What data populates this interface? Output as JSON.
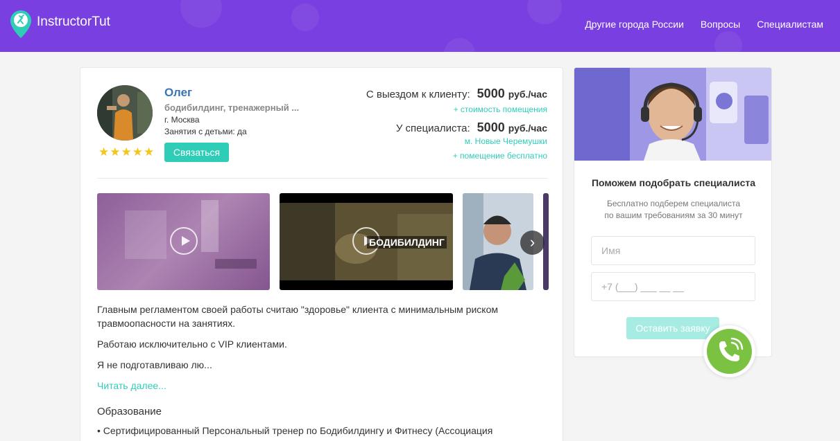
{
  "header": {
    "logo_text": "InstructorTut",
    "nav": [
      "Другие города России",
      "Вопросы",
      "Специалистам"
    ]
  },
  "profile": {
    "name": "Олег",
    "specialization": "бодибилдинг, тренажерный ...",
    "city": "г. Москва",
    "kids": "Занятия с детьми: да",
    "rating": 5,
    "contact_label": "Связаться",
    "prices": {
      "visit_label": "С выездом к клиенту:",
      "visit_value": "5000",
      "visit_unit": "руб./час",
      "visit_note": "+ стоимость помещения",
      "own_label": "У специалиста:",
      "own_value": "5000",
      "own_unit": "руб./час",
      "own_metro": "м. Новые Черемушки",
      "own_note": "+ помещение бесплатно"
    },
    "media": {
      "video2_caption": "БОДИБИЛДИНГ",
      "next_arrow": "›"
    },
    "description": [
      "Главным регламентом своей работы считаю \"здоровье\" клиента с минимальным риском травмоопасности на занятиях.",
      "Работаю исключительно с VIP клиентами.",
      "Я не подготавливаю лю..."
    ],
    "read_more": "Читать далее...",
    "education_title": "Образование",
    "education_item": "• Сертифицированный Персональный тренер по Бодибилдингу и Фитнесу (Ассоциация"
  },
  "sidebar": {
    "title": "Поможем подобрать специалиста",
    "subtitle_line1": "Бесплатно подберем специалиста",
    "subtitle_line2": "по вашим требованиям за 30 минут",
    "name_placeholder": "Имя",
    "phone_placeholder": "+7 (___) ___ __ __",
    "submit_label": "Оставить заявку"
  },
  "colors": {
    "header_bg": "#7a3fe0",
    "accent": "#2fcdb8",
    "link": "#3b73b9",
    "star": "#f5c518",
    "phone_fab": "#7cc242"
  },
  "icons": [
    "logo-pin-icon",
    "star-icon",
    "play-icon",
    "chevron-right-icon",
    "phone-icon"
  ]
}
